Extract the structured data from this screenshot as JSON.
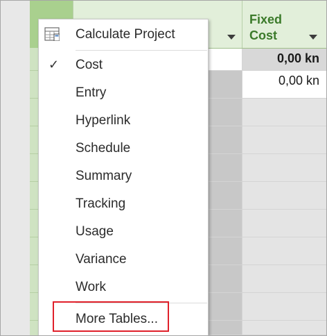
{
  "columns": {
    "fixed_cost_label": "Fixed\nCost"
  },
  "cells": {
    "summary_fixed_cost": "0,00 kn",
    "row1_fixed_cost": "0,00 kn"
  },
  "menu": {
    "calculate_project": "Calculate Project",
    "items": [
      {
        "label": "Cost",
        "checked": true
      },
      {
        "label": "Entry"
      },
      {
        "label": "Hyperlink"
      },
      {
        "label": "Schedule"
      },
      {
        "label": "Summary"
      },
      {
        "label": "Tracking"
      },
      {
        "label": "Usage"
      },
      {
        "label": "Variance"
      },
      {
        "label": "Work"
      }
    ],
    "more_tables": "More Tables...",
    "check_glyph": "✓"
  },
  "colors": {
    "header_green": "#a9d08e",
    "highlight_red": "#e0202a"
  }
}
